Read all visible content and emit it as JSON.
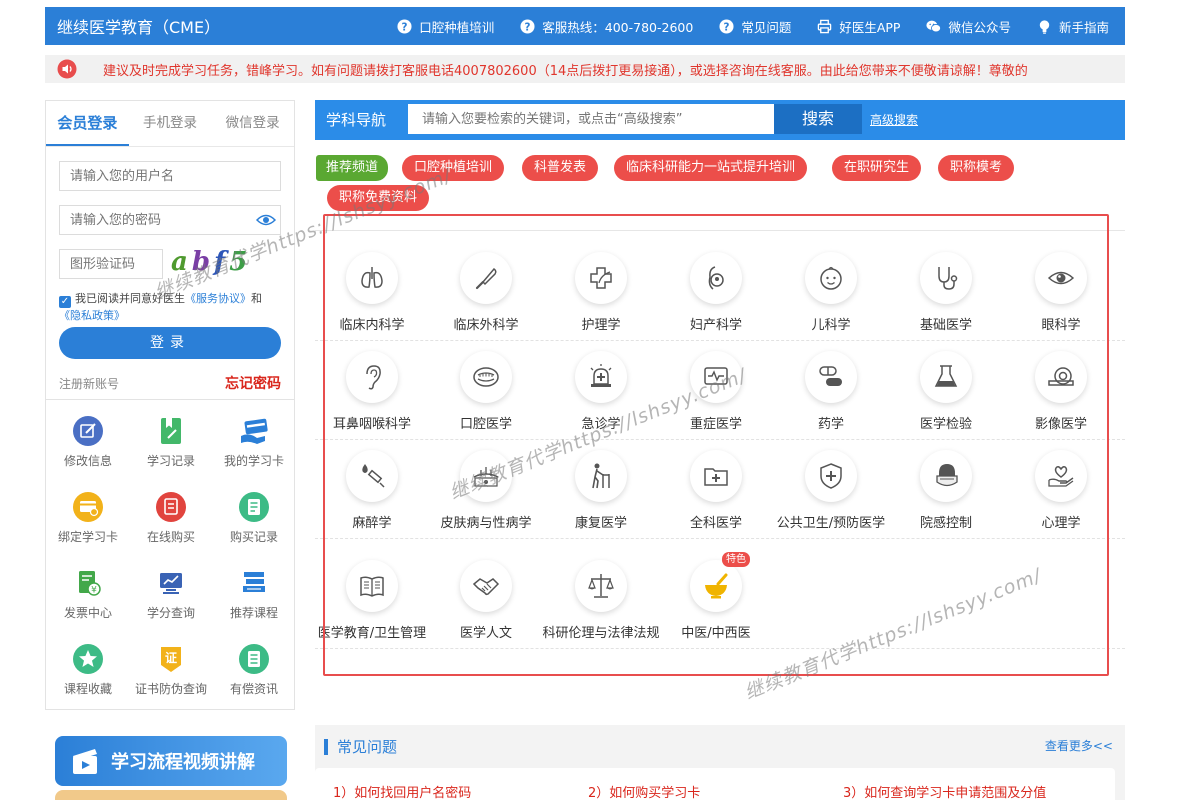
{
  "header": {
    "brand": "继续医学教育（CME）",
    "nav": [
      {
        "label": "口腔种植培训",
        "icon": "question-circle-icon"
      },
      {
        "label": "客服热线：400-780-2600",
        "icon": "question-circle-icon"
      },
      {
        "label": "常见问题",
        "icon": "question-circle-icon"
      },
      {
        "label": "好医生APP",
        "icon": "printer-icon"
      },
      {
        "label": "微信公众号",
        "icon": "wechat-icon"
      },
      {
        "label": "新手指南",
        "icon": "lightbulb-icon"
      }
    ]
  },
  "notice": {
    "text": "建议及时完成学习任务，错峰学习。如有问题请拨打客服电话4007802600（14点后拨打更易接通），或选择咨询在线客服。由此给您带来不便敬请谅解！尊敬的"
  },
  "login": {
    "tabs": [
      "会员登录",
      "手机登录",
      "微信登录"
    ],
    "username_placeholder": "请输入您的用户名",
    "password_placeholder": "请输入您的密码",
    "captcha_placeholder": "图形验证码",
    "captcha_chars": [
      "a",
      "b",
      "f",
      "5",
      ""
    ],
    "agree_prefix": "我已阅读并同意好医生",
    "service_link": "《服务协议》",
    "and": "和",
    "privacy_link": "《隐私政策》",
    "login_button": "登录",
    "register": "注册新账号",
    "forgot": "忘记密码"
  },
  "functions": [
    {
      "label": "修改信息",
      "icon": "edit-icon",
      "color": "#4a6fc4"
    },
    {
      "label": "学习记录",
      "icon": "bookmark-edit-icon",
      "color": "#43b86a"
    },
    {
      "label": "我的学习卡",
      "icon": "card-hand-icon",
      "color": "#2b7fd7"
    },
    {
      "label": "绑定学习卡",
      "icon": "bind-card-icon",
      "color": "#f2b21a"
    },
    {
      "label": "在线购买",
      "icon": "online-buy-icon",
      "color": "#e1443e"
    },
    {
      "label": "购买记录",
      "icon": "list-record-icon",
      "color": "#3dbb86"
    },
    {
      "label": "发票中心",
      "icon": "invoice-icon",
      "color": "#43a84a"
    },
    {
      "label": "学分查询",
      "icon": "credit-query-icon",
      "color": "#3a63b5"
    },
    {
      "label": "推荐课程",
      "icon": "books-icon",
      "color": "#2b7fd7"
    },
    {
      "label": "课程收藏",
      "icon": "star-icon",
      "color": "#3dbb86"
    },
    {
      "label": "证书防伪查询",
      "icon": "certificate-icon",
      "color": "#f2b21a"
    },
    {
      "label": "有偿资讯",
      "icon": "paid-info-icon",
      "color": "#3dbb86"
    }
  ],
  "subject_nav": {
    "title": "学科导航",
    "search_placeholder": "请输入您要检索的关键词，或点击“高级搜索”",
    "search_button": "搜索",
    "advanced": "高级搜索"
  },
  "recommend": {
    "label": "推荐频道",
    "tags": [
      "口腔种植培训",
      "科普发表",
      "临床科研能力一站式提升培训",
      "在职研究生",
      "职称模考",
      "职称免费资料"
    ]
  },
  "subjects": [
    {
      "name": "临床内科学",
      "icon": "lungs-icon"
    },
    {
      "name": "临床外科学",
      "icon": "scalpel-icon"
    },
    {
      "name": "护理学",
      "icon": "nursing-cross-icon"
    },
    {
      "name": "妇产科学",
      "icon": "pregnancy-icon"
    },
    {
      "name": "儿科学",
      "icon": "baby-face-icon"
    },
    {
      "name": "基础医学",
      "icon": "stethoscope-icon"
    },
    {
      "name": "眼科学",
      "icon": "eye-icon"
    },
    {
      "name": "耳鼻咽喉科学",
      "icon": "ear-icon"
    },
    {
      "name": "口腔医学",
      "icon": "mouth-icon"
    },
    {
      "name": "急诊学",
      "icon": "emergency-light-icon"
    },
    {
      "name": "重症医学",
      "icon": "monitor-icon"
    },
    {
      "name": "药学",
      "icon": "pill-icon"
    },
    {
      "name": "医学检验",
      "icon": "flask-icon"
    },
    {
      "name": "影像医学",
      "icon": "ct-scanner-icon"
    },
    {
      "name": "麻醉学",
      "icon": "syringe-icon"
    },
    {
      "name": "皮肤病与性病学",
      "icon": "skin-icon"
    },
    {
      "name": "康复医学",
      "icon": "walker-icon"
    },
    {
      "name": "全科医学",
      "icon": "medical-folder-icon"
    },
    {
      "name": "公共卫生/预防医学",
      "icon": "shield-plus-icon"
    },
    {
      "name": "院感控制",
      "icon": "mask-icon"
    },
    {
      "name": "心理学",
      "icon": "heart-hand-icon"
    },
    {
      "name": "医学教育/卫生管理",
      "icon": "open-book-icon"
    },
    {
      "name": "医学人文",
      "icon": "handshake-icon"
    },
    {
      "name": "科研伦理与法律法规",
      "icon": "scales-icon"
    },
    {
      "name": "中医/中西医",
      "icon": "mortar-icon",
      "badge": "特色"
    }
  ],
  "promo": {
    "label": "学习流程视频讲解"
  },
  "faq": {
    "title": "常见问题",
    "more": "查看更多<<",
    "items": [
      "1）如何找回用户名密码",
      "2）如何购买学习卡",
      "3）如何查询学习卡申请范围及分值"
    ]
  },
  "watermark": {
    "text": "继续教育代学https://lshsyy.com/"
  }
}
